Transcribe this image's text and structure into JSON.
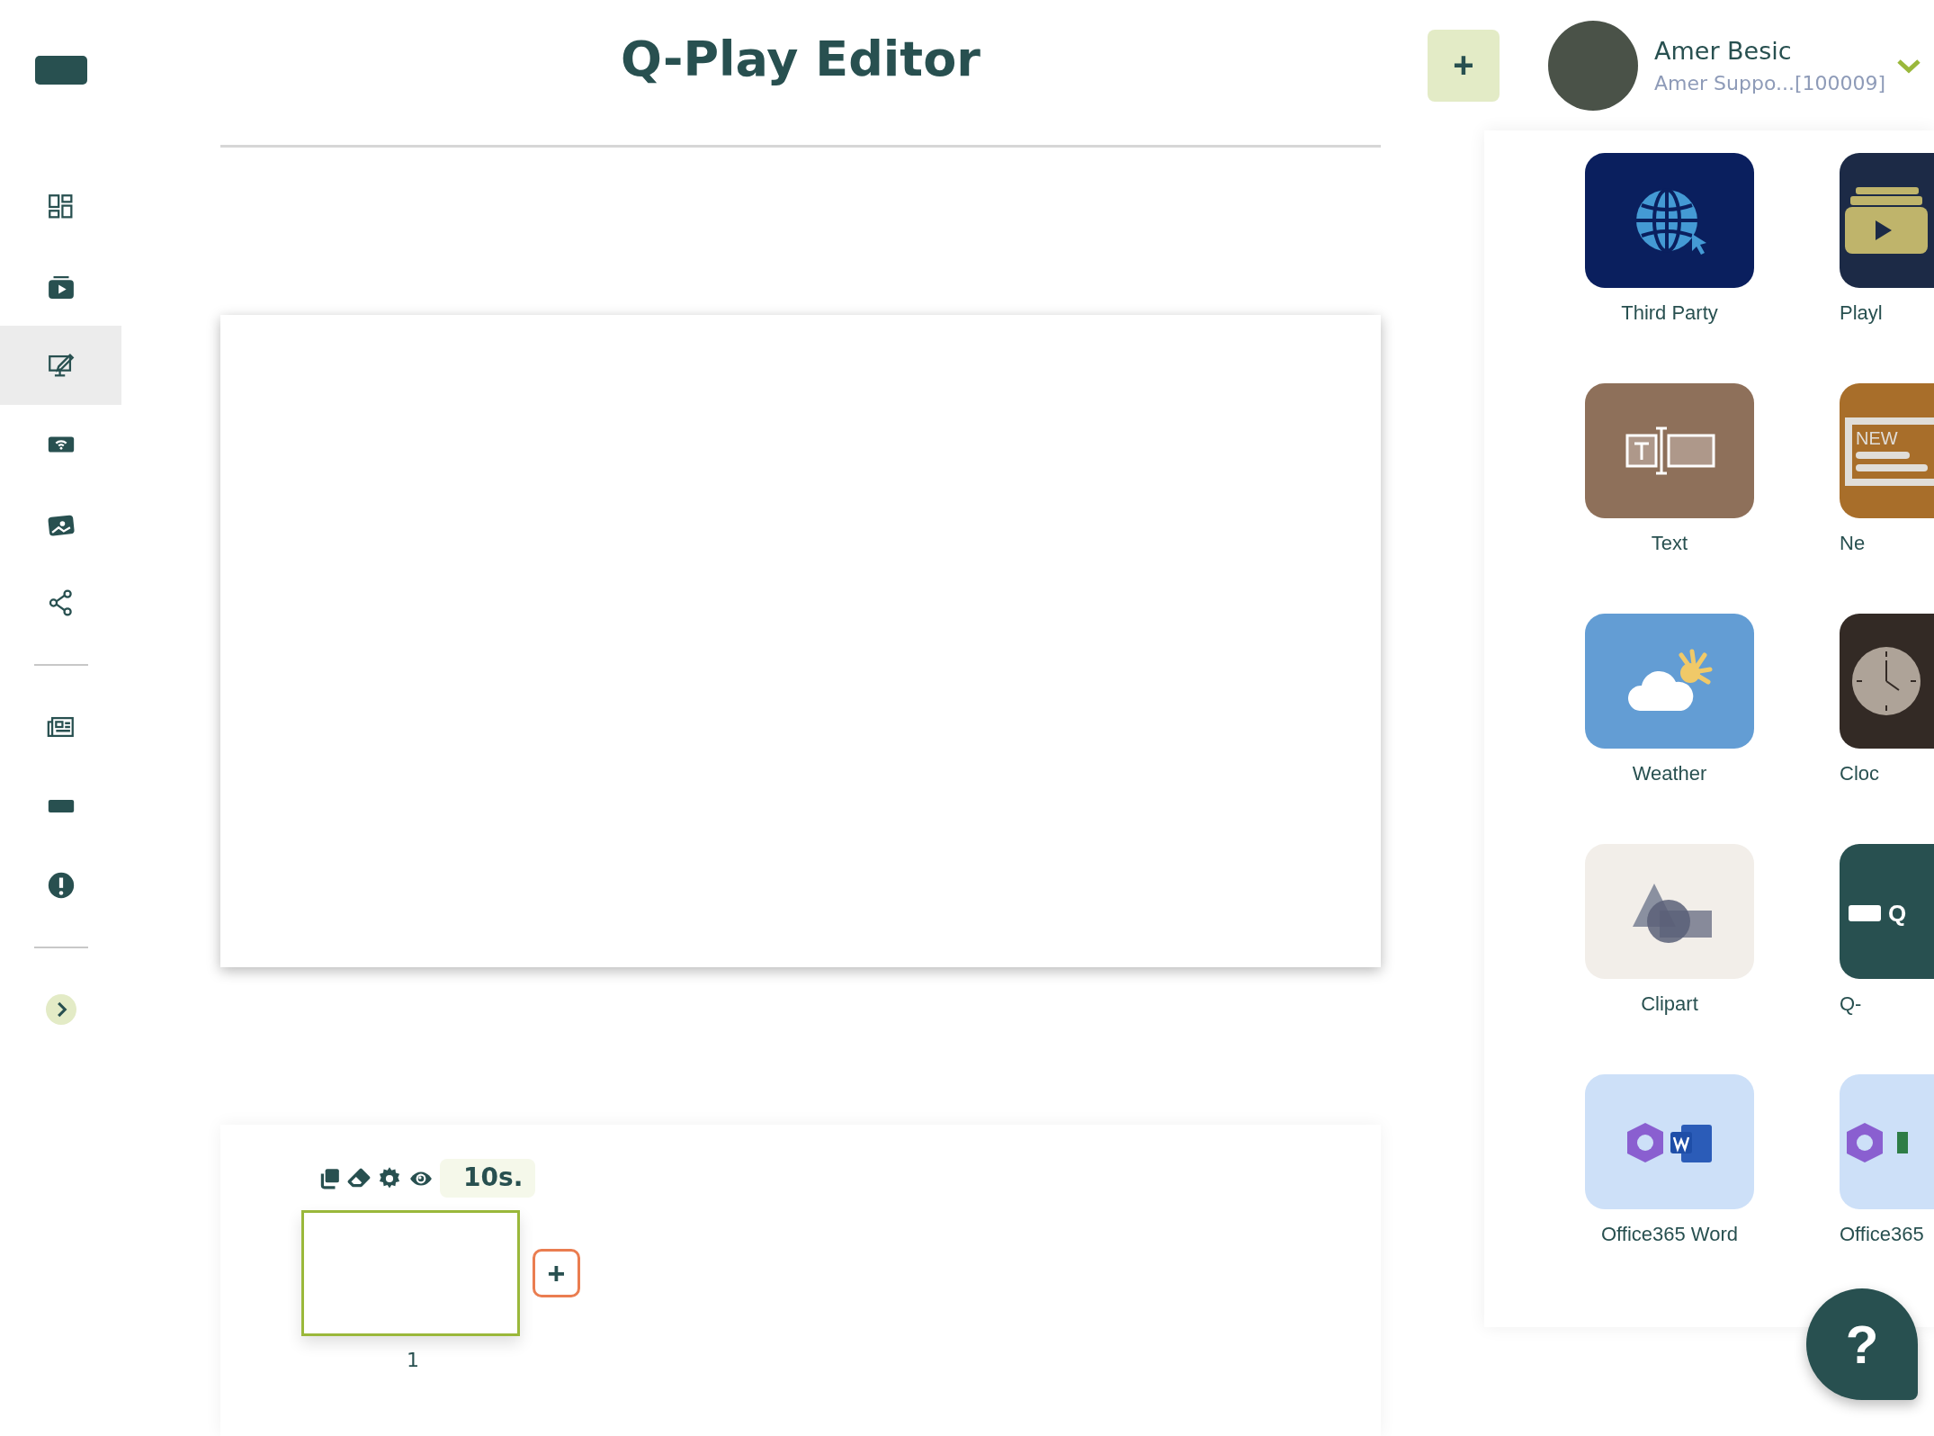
{
  "header": {
    "title": "Q-Play Editor",
    "add_button": "+",
    "user": {
      "name": "Amer Besic",
      "account": "Amer Suppo...[100009]"
    }
  },
  "sidebar": {
    "groups": [
      [
        {
          "kind": "dashboard",
          "selected": false
        },
        {
          "kind": "player",
          "selected": false
        },
        {
          "kind": "editor",
          "selected": true
        },
        {
          "kind": "wifi",
          "selected": false
        },
        {
          "kind": "media",
          "selected": false
        },
        {
          "kind": "share",
          "selected": false
        }
      ],
      [
        {
          "kind": "news",
          "selected": false
        },
        {
          "kind": "block",
          "selected": false
        },
        {
          "kind": "alert",
          "selected": false
        }
      ],
      [
        {
          "kind": "expand",
          "selected": false
        }
      ]
    ]
  },
  "app_rows": [
    [
      {
        "kind": "thirdparty",
        "label": "Third Party"
      },
      {
        "kind": "playlist",
        "label": "Playl"
      }
    ],
    [
      {
        "kind": "text",
        "label": "Text"
      },
      {
        "kind": "news",
        "label": "Ne",
        "icon_text": "NEW"
      }
    ],
    [
      {
        "kind": "weather",
        "label": "Weather"
      },
      {
        "kind": "clock",
        "label": "Cloc"
      }
    ],
    [
      {
        "kind": "clipart",
        "label": "Clipart"
      },
      {
        "kind": "qapp",
        "label": "Q-",
        "icon_text": "Q"
      }
    ],
    [
      {
        "kind": "word",
        "label": "Office365 Word"
      },
      {
        "kind": "office",
        "label": "Office365"
      }
    ]
  ],
  "slides": [
    {
      "number": "1",
      "duration": "10s.",
      "selected": true
    }
  ],
  "add_slide_button": "+",
  "help_button": "?"
}
